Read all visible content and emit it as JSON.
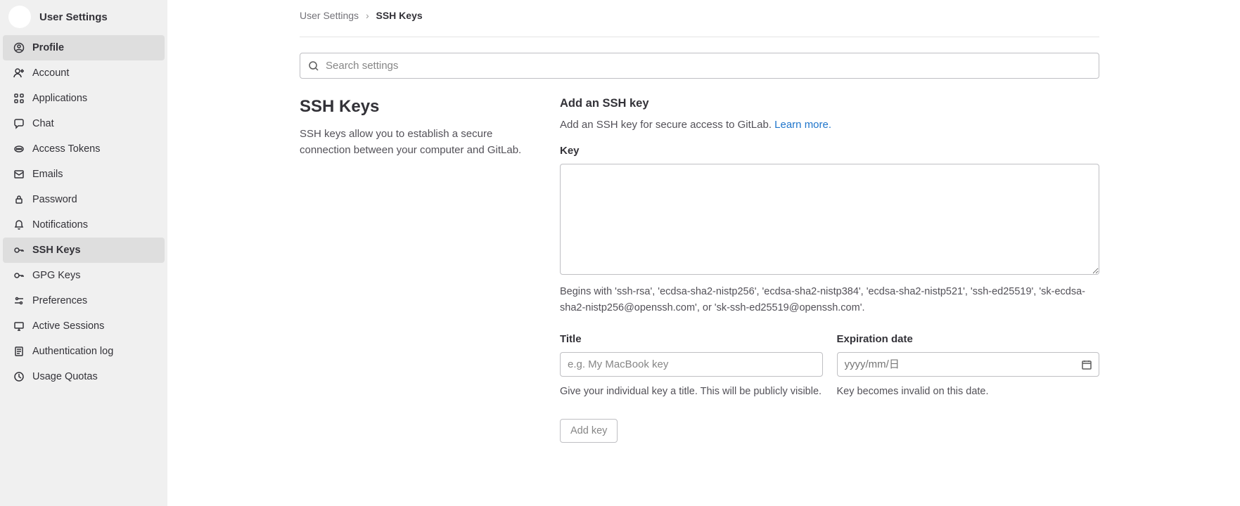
{
  "sidebar": {
    "title": "User Settings",
    "items": [
      {
        "label": "Profile",
        "icon": "profile"
      },
      {
        "label": "Account",
        "icon": "account"
      },
      {
        "label": "Applications",
        "icon": "applications"
      },
      {
        "label": "Chat",
        "icon": "chat"
      },
      {
        "label": "Access Tokens",
        "icon": "tokens"
      },
      {
        "label": "Emails",
        "icon": "emails"
      },
      {
        "label": "Password",
        "icon": "password"
      },
      {
        "label": "Notifications",
        "icon": "notifications"
      },
      {
        "label": "SSH Keys",
        "icon": "ssh"
      },
      {
        "label": "GPG Keys",
        "icon": "gpg"
      },
      {
        "label": "Preferences",
        "icon": "preferences"
      },
      {
        "label": "Active Sessions",
        "icon": "sessions"
      },
      {
        "label": "Authentication log",
        "icon": "authlog"
      },
      {
        "label": "Usage Quotas",
        "icon": "quotas"
      }
    ]
  },
  "breadcrumb": {
    "parent": "User Settings",
    "current": "SSH Keys"
  },
  "search": {
    "placeholder": "Search settings"
  },
  "section": {
    "title": "SSH Keys",
    "description": "SSH keys allow you to establish a secure connection between your computer and GitLab."
  },
  "form": {
    "heading": "Add an SSH key",
    "subdesc": "Add an SSH key for secure access to GitLab. ",
    "learn_more": "Learn more.",
    "key_label": "Key",
    "key_help": "Begins with 'ssh-rsa', 'ecdsa-sha2-nistp256', 'ecdsa-sha2-nistp384', 'ecdsa-sha2-nistp521', 'ssh-ed25519', 'sk-ecdsa-sha2-nistp256@openssh.com', or 'sk-ssh-ed25519@openssh.com'.",
    "title_label": "Title",
    "title_placeholder": "e.g. My MacBook key",
    "title_help": "Give your individual key a title. This will be publicly visible.",
    "expire_label": "Expiration date",
    "expire_placeholder": "yyyy/mm/日",
    "expire_help": "Key becomes invalid on this date.",
    "submit": "Add key"
  }
}
